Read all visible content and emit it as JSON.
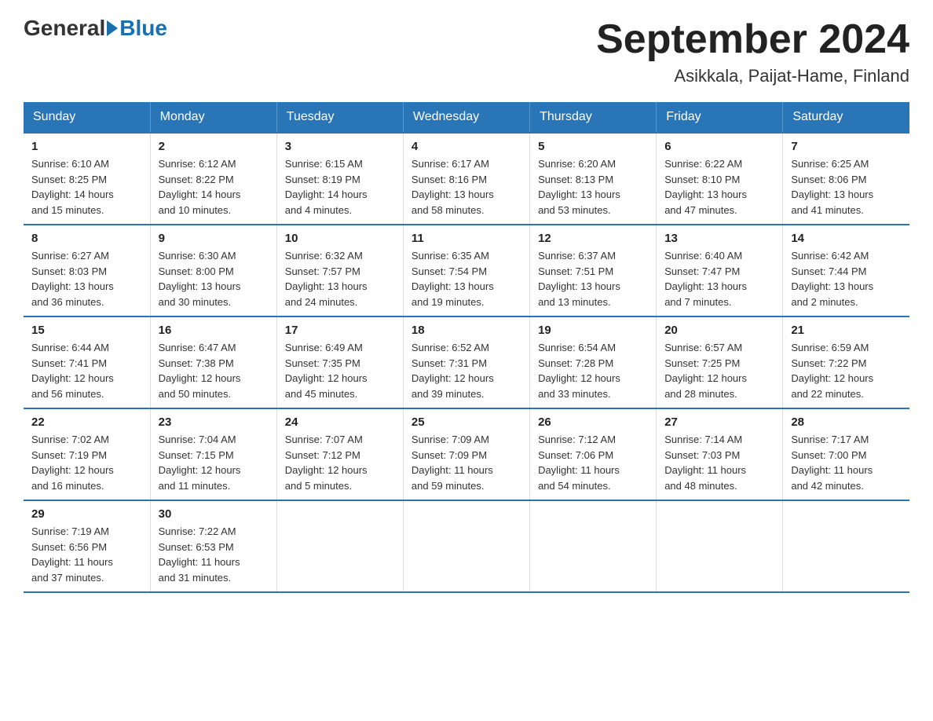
{
  "header": {
    "logo_general": "General",
    "logo_blue": "Blue",
    "month_title": "September 2024",
    "location": "Asikkala, Paijat-Hame, Finland"
  },
  "weekdays": [
    "Sunday",
    "Monday",
    "Tuesday",
    "Wednesday",
    "Thursday",
    "Friday",
    "Saturday"
  ],
  "weeks": [
    [
      {
        "day": "1",
        "sunrise": "6:10 AM",
        "sunset": "8:25 PM",
        "daylight": "14 hours and 15 minutes."
      },
      {
        "day": "2",
        "sunrise": "6:12 AM",
        "sunset": "8:22 PM",
        "daylight": "14 hours and 10 minutes."
      },
      {
        "day": "3",
        "sunrise": "6:15 AM",
        "sunset": "8:19 PM",
        "daylight": "14 hours and 4 minutes."
      },
      {
        "day": "4",
        "sunrise": "6:17 AM",
        "sunset": "8:16 PM",
        "daylight": "13 hours and 58 minutes."
      },
      {
        "day": "5",
        "sunrise": "6:20 AM",
        "sunset": "8:13 PM",
        "daylight": "13 hours and 53 minutes."
      },
      {
        "day": "6",
        "sunrise": "6:22 AM",
        "sunset": "8:10 PM",
        "daylight": "13 hours and 47 minutes."
      },
      {
        "day": "7",
        "sunrise": "6:25 AM",
        "sunset": "8:06 PM",
        "daylight": "13 hours and 41 minutes."
      }
    ],
    [
      {
        "day": "8",
        "sunrise": "6:27 AM",
        "sunset": "8:03 PM",
        "daylight": "13 hours and 36 minutes."
      },
      {
        "day": "9",
        "sunrise": "6:30 AM",
        "sunset": "8:00 PM",
        "daylight": "13 hours and 30 minutes."
      },
      {
        "day": "10",
        "sunrise": "6:32 AM",
        "sunset": "7:57 PM",
        "daylight": "13 hours and 24 minutes."
      },
      {
        "day": "11",
        "sunrise": "6:35 AM",
        "sunset": "7:54 PM",
        "daylight": "13 hours and 19 minutes."
      },
      {
        "day": "12",
        "sunrise": "6:37 AM",
        "sunset": "7:51 PM",
        "daylight": "13 hours and 13 minutes."
      },
      {
        "day": "13",
        "sunrise": "6:40 AM",
        "sunset": "7:47 PM",
        "daylight": "13 hours and 7 minutes."
      },
      {
        "day": "14",
        "sunrise": "6:42 AM",
        "sunset": "7:44 PM",
        "daylight": "13 hours and 2 minutes."
      }
    ],
    [
      {
        "day": "15",
        "sunrise": "6:44 AM",
        "sunset": "7:41 PM",
        "daylight": "12 hours and 56 minutes."
      },
      {
        "day": "16",
        "sunrise": "6:47 AM",
        "sunset": "7:38 PM",
        "daylight": "12 hours and 50 minutes."
      },
      {
        "day": "17",
        "sunrise": "6:49 AM",
        "sunset": "7:35 PM",
        "daylight": "12 hours and 45 minutes."
      },
      {
        "day": "18",
        "sunrise": "6:52 AM",
        "sunset": "7:31 PM",
        "daylight": "12 hours and 39 minutes."
      },
      {
        "day": "19",
        "sunrise": "6:54 AM",
        "sunset": "7:28 PM",
        "daylight": "12 hours and 33 minutes."
      },
      {
        "day": "20",
        "sunrise": "6:57 AM",
        "sunset": "7:25 PM",
        "daylight": "12 hours and 28 minutes."
      },
      {
        "day": "21",
        "sunrise": "6:59 AM",
        "sunset": "7:22 PM",
        "daylight": "12 hours and 22 minutes."
      }
    ],
    [
      {
        "day": "22",
        "sunrise": "7:02 AM",
        "sunset": "7:19 PM",
        "daylight": "12 hours and 16 minutes."
      },
      {
        "day": "23",
        "sunrise": "7:04 AM",
        "sunset": "7:15 PM",
        "daylight": "12 hours and 11 minutes."
      },
      {
        "day": "24",
        "sunrise": "7:07 AM",
        "sunset": "7:12 PM",
        "daylight": "12 hours and 5 minutes."
      },
      {
        "day": "25",
        "sunrise": "7:09 AM",
        "sunset": "7:09 PM",
        "daylight": "11 hours and 59 minutes."
      },
      {
        "day": "26",
        "sunrise": "7:12 AM",
        "sunset": "7:06 PM",
        "daylight": "11 hours and 54 minutes."
      },
      {
        "day": "27",
        "sunrise": "7:14 AM",
        "sunset": "7:03 PM",
        "daylight": "11 hours and 48 minutes."
      },
      {
        "day": "28",
        "sunrise": "7:17 AM",
        "sunset": "7:00 PM",
        "daylight": "11 hours and 42 minutes."
      }
    ],
    [
      {
        "day": "29",
        "sunrise": "7:19 AM",
        "sunset": "6:56 PM",
        "daylight": "11 hours and 37 minutes."
      },
      {
        "day": "30",
        "sunrise": "7:22 AM",
        "sunset": "6:53 PM",
        "daylight": "11 hours and 31 minutes."
      },
      null,
      null,
      null,
      null,
      null
    ]
  ],
  "labels": {
    "sunrise": "Sunrise:",
    "sunset": "Sunset:",
    "daylight": "Daylight:"
  }
}
